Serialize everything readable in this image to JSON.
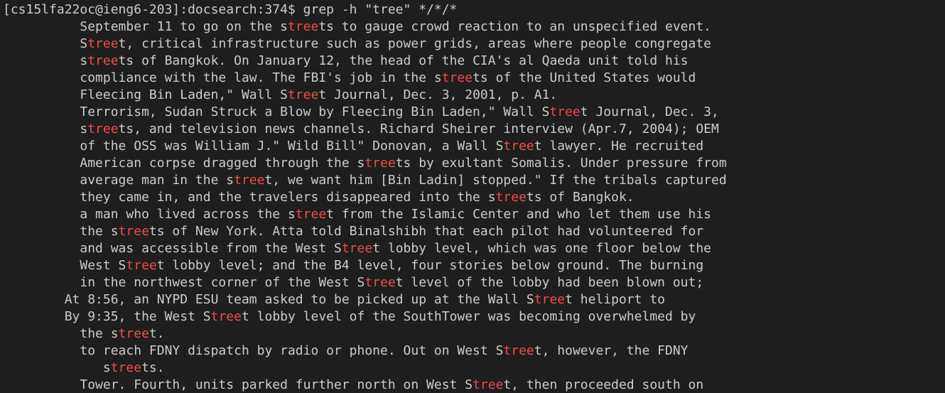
{
  "terminal": {
    "colors": {
      "background": "#1e1e1e",
      "foreground": "#cccccc",
      "match": "#f14c4c"
    },
    "prompt": "[cs15lfa22oc@ieng6-203]:docsearch:374$ ",
    "command": "grep -h \"tree\" */*/*",
    "match_term": "tree",
    "output_lines": [
      "          September 11 to go on the streets to gauge crowd reaction to an unspecified event.",
      "          Street, critical infrastructure such as power grids, areas where people congregate",
      "          streets of Bangkok. On January 12, the head of the CIA's al Qaeda unit told his",
      "          compliance with the law. The FBI's job in the streets of the United States would",
      "          Fleecing Bin Laden,\" Wall Street Journal, Dec. 3, 2001, p. A1.",
      "          Terrorism, Sudan Struck a Blow by Fleecing Bin Laden,\" Wall Street Journal, Dec. 3,",
      "          streets, and television news channels. Richard Sheirer interview (Apr.7, 2004); OEM",
      "          of the OSS was William J.\" Wild Bill\" Donovan, a Wall Street lawyer. He recruited",
      "          American corpse dragged through the streets by exultant Somalis. Under pressure from",
      "          average man in the street, we want him [Bin Ladin] stopped.\" If the tribals captured",
      "          they came in, and the travelers disappeared into the streets of Bangkok.",
      "          a man who lived across the street from the Islamic Center and who let them use his",
      "          the streets of New York. Atta told Binalshibh that each pilot had volunteered for",
      "          and was accessible from the West Street lobby level, which was one floor below the",
      "          West Street lobby level; and the B4 level, four stories below ground. The burning",
      "          in the northwest corner of the West Street level of the lobby had been blown out;",
      "        At 8:56, an NYPD ESU team asked to be picked up at the Wall Street heliport to",
      "        By 9:35, the West Street lobby level of the SouthTower was becoming overwhelmed by",
      "          the street.",
      "          to reach FDNY dispatch by radio or phone. Out on West Street, however, the FDNY",
      "             streets.",
      "          Tower. Fourth, units parked further north on West Street, then proceeded south on"
    ]
  }
}
